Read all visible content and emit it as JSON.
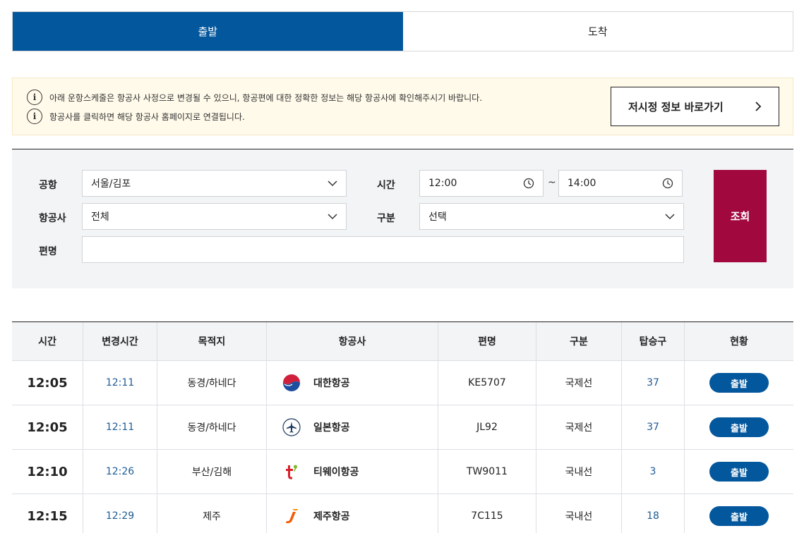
{
  "tabs": [
    {
      "label": "출발",
      "active": true
    },
    {
      "label": "도착",
      "active": false
    }
  ],
  "notice": {
    "line1": "아래 운항스케줄은 항공사 사정으로 변경될 수 있으니, 항공편에 대한 정확한 정보는 해당 항공사에 확인해주시기 바랍니다.",
    "line2": "항공사를 클릭하면 해당 항공사 홈페이지로 연결됩니다.",
    "info_icon": "info-icon",
    "button_label": "저시정 정보 바로가기",
    "button_icon": "chevron-right-icon"
  },
  "search": {
    "airport_label": "공항",
    "airport_value": "서울/김포",
    "airline_label": "항공사",
    "airline_value": "전체",
    "flight_label": "편명",
    "flight_value": "",
    "time_label": "시간",
    "time_from": "12:00",
    "time_sep": "~",
    "time_to": "14:00",
    "type_label": "구분",
    "type_value": "선택",
    "query_label": "조회"
  },
  "table": {
    "headers": [
      "시간",
      "변경시간",
      "목적지",
      "항공사",
      "편명",
      "구분",
      "탑승구",
      "현황"
    ],
    "rows": [
      {
        "time": "12:05",
        "changed": "12:11",
        "dest": "동경/하네다",
        "airline": "대한항공",
        "logo": "korean-air-logo",
        "flight": "KE5707",
        "type": "국제선",
        "gate": "37",
        "status": "출발"
      },
      {
        "time": "12:05",
        "changed": "12:11",
        "dest": "동경/하네다",
        "airline": "일본항공",
        "logo": "plane-icon",
        "flight": "JL92",
        "type": "국제선",
        "gate": "37",
        "status": "출발"
      },
      {
        "time": "12:10",
        "changed": "12:26",
        "dest": "부산/김해",
        "airline": "티웨이항공",
        "logo": "tway-logo",
        "flight": "TW9011",
        "type": "국내선",
        "gate": "3",
        "status": "출발"
      },
      {
        "time": "12:15",
        "changed": "12:29",
        "dest": "제주",
        "airline": "제주항공",
        "logo": "jeju-air-logo",
        "flight": "7C115",
        "type": "국내선",
        "gate": "18",
        "status": "출발"
      }
    ]
  },
  "colors": {
    "primary": "#03579d",
    "query_button": "#a1093e",
    "notice_bg": "#fffaea",
    "link_blue": "#1e5b94"
  }
}
